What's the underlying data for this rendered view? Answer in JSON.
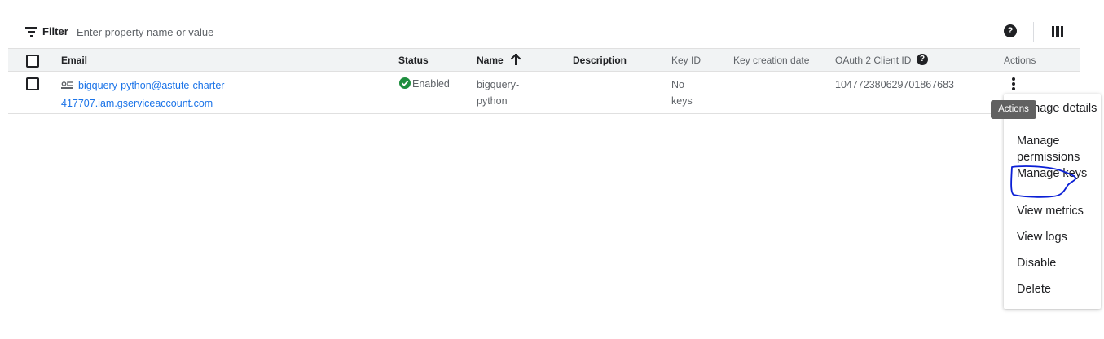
{
  "toolbar": {
    "filter_label": "Filter",
    "filter_placeholder": "Enter property name or value",
    "help_icon": "?",
    "icons": {
      "filter": "filter-lines-icon",
      "help": "help-circle-icon",
      "columns": "column-display-icon"
    }
  },
  "table": {
    "headers": {
      "email": "Email",
      "status": "Status",
      "name": "Name",
      "description": "Description",
      "key_id": "Key ID",
      "key_creation_date": "Key creation date",
      "oauth_client_id": "OAuth 2 Client ID",
      "actions": "Actions"
    },
    "sort": {
      "column": "Name",
      "direction": "ascending"
    },
    "rows": [
      {
        "email": "bigquery-python@astute-charter-417707.iam.gserviceaccount.com",
        "status": "Enabled",
        "name": "bigquery-python",
        "description": "",
        "key_id": "No keys",
        "key_creation_date": "",
        "oauth_client_id": "104772380629701867683"
      }
    ]
  },
  "tooltip": {
    "text": "Actions"
  },
  "actions_menu": {
    "items": [
      {
        "label": "Manage details"
      },
      {
        "label": "Manage permissions"
      },
      {
        "label": "Manage keys",
        "highlighted": true
      },
      {
        "label": "View metrics"
      },
      {
        "label": "View logs"
      },
      {
        "label": "Disable"
      },
      {
        "label": "Delete"
      }
    ]
  },
  "colors": {
    "link": "#1a73e8",
    "status_enabled": "#1e8e3e",
    "header_bg": "#f1f3f4",
    "tooltip_bg": "#616161",
    "annotation_stroke": "#0a1fd6"
  }
}
